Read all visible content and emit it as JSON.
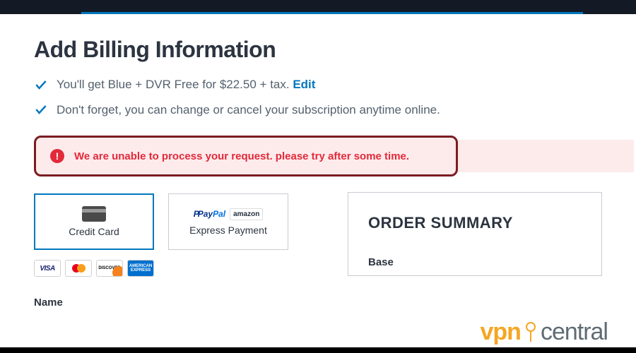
{
  "header": {
    "title": "Add Billing Information"
  },
  "bullets": [
    {
      "text": "You'll get Blue + DVR Free for $22.50 + tax.",
      "edit": "Edit"
    },
    {
      "text": "Don't forget, you can change or cancel your subscription anytime online."
    }
  ],
  "error": {
    "text": "We are unable to process your request. please try after some time."
  },
  "payment_methods": {
    "credit_card": {
      "label": "Credit Card",
      "selected": true
    },
    "express": {
      "label": "Express Payment",
      "selected": false
    }
  },
  "accepted_cards": [
    "VISA",
    "Mastercard",
    "Discover",
    "American Express"
  ],
  "form": {
    "name_label": "Name"
  },
  "summary": {
    "title": "ORDER SUMMARY",
    "line1_label": "Base"
  },
  "watermark": {
    "part1": "vpn",
    "part2": "central"
  }
}
